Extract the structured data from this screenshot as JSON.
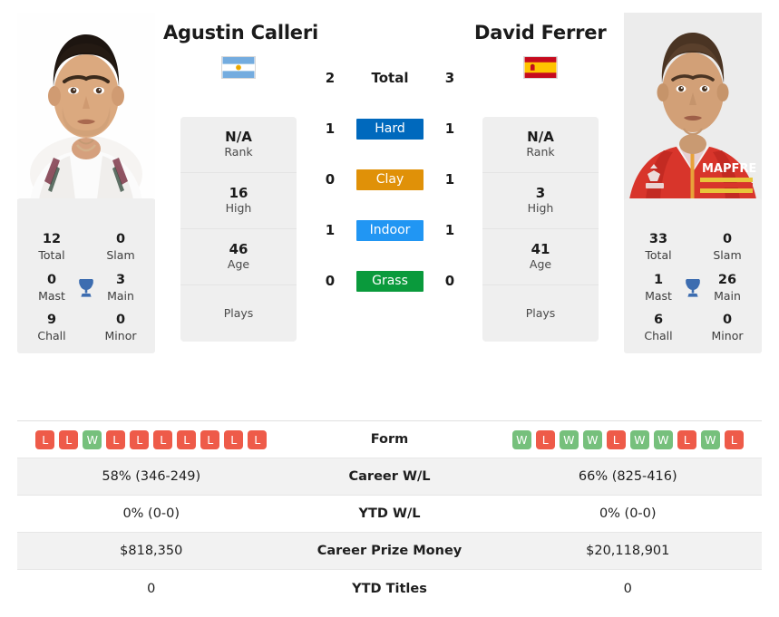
{
  "players": {
    "left": {
      "name": "Agustin Calleri",
      "photo_caption": "Agustin Calleri",
      "country": "Argentina",
      "flag_icon": "flag-argentina",
      "rank": "N/A",
      "rank_label": "Rank",
      "high": "16",
      "high_label": "High",
      "age": "46",
      "age_label": "Age",
      "plays": "",
      "plays_label": "Plays",
      "titles": {
        "total": "12",
        "total_label": "Total",
        "slam": "0",
        "slam_label": "Slam",
        "mast": "0",
        "mast_label": "Mast",
        "main": "3",
        "main_label": "Main",
        "chall": "9",
        "chall_label": "Chall",
        "minor": "0",
        "minor_label": "Minor"
      },
      "form": [
        "L",
        "L",
        "W",
        "L",
        "L",
        "L",
        "L",
        "L",
        "L",
        "L"
      ],
      "career_wl": "58% (346-249)",
      "ytd_wl": "0% (0-0)",
      "career_prize_money": "$818,350",
      "ytd_titles": "0"
    },
    "right": {
      "name": "David Ferrer",
      "photo_caption": "David Ferrer",
      "country": "Spain",
      "flag_icon": "flag-spain",
      "rank": "N/A",
      "rank_label": "Rank",
      "high": "3",
      "high_label": "High",
      "age": "41",
      "age_label": "Age",
      "plays": "",
      "plays_label": "Plays",
      "titles": {
        "total": "33",
        "total_label": "Total",
        "slam": "0",
        "slam_label": "Slam",
        "mast": "1",
        "mast_label": "Mast",
        "main": "26",
        "main_label": "Main",
        "chall": "6",
        "chall_label": "Chall",
        "minor": "0",
        "minor_label": "Minor"
      },
      "form": [
        "W",
        "L",
        "W",
        "W",
        "L",
        "W",
        "W",
        "L",
        "W",
        "L"
      ],
      "career_wl": "66% (825-416)",
      "ytd_wl": "0% (0-0)",
      "career_prize_money": "$20,118,901",
      "ytd_titles": "0"
    }
  },
  "head_to_head": [
    {
      "label": "Total",
      "left": "2",
      "right": "3",
      "type": "text",
      "color": ""
    },
    {
      "label": "Hard",
      "left": "1",
      "right": "1",
      "type": "chip",
      "color": "#0069bd"
    },
    {
      "label": "Clay",
      "left": "0",
      "right": "1",
      "type": "chip",
      "color": "#e09108"
    },
    {
      "label": "Indoor",
      "left": "1",
      "right": "1",
      "type": "chip",
      "color": "#2196f3"
    },
    {
      "label": "Grass",
      "left": "0",
      "right": "0",
      "type": "chip",
      "color": "#0a9a3c"
    }
  ],
  "stats_rows": [
    {
      "label": "Form",
      "left": "",
      "right": "",
      "shade": false,
      "badges": true
    },
    {
      "label": "Career W/L",
      "left": "58% (346-249)",
      "right": "66% (825-416)",
      "shade": true,
      "badges": false
    },
    {
      "label": "YTD W/L",
      "left": "0% (0-0)",
      "right": "0% (0-0)",
      "shade": false,
      "badges": false
    },
    {
      "label": "Career Prize Money",
      "left": "$818,350",
      "right": "$20,118,901",
      "shade": true,
      "badges": false
    },
    {
      "label": "YTD Titles",
      "left": "0",
      "right": "0",
      "shade": false,
      "badges": false
    }
  ],
  "icons": {
    "trophy": "trophy-icon"
  },
  "colors": {
    "hard": "#0069bd",
    "clay": "#e09108",
    "indoor": "#2196f3",
    "grass": "#0a9a3c",
    "win_badge": "#76c07c",
    "loss_badge": "#ee5b49",
    "trophy": "#3d6db0",
    "card_bg": "#efefef",
    "row_shade": "#f2f2f2"
  }
}
